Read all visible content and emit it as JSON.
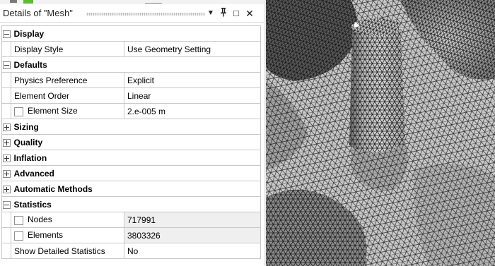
{
  "details": {
    "title": "Details of \"Mesh\"",
    "window_buttons": {
      "dropdown": "▼",
      "pin": "⊥",
      "maximize": "□",
      "close": "✕"
    },
    "rows": [
      {
        "type": "category",
        "label": "Display",
        "expanded": true
      },
      {
        "type": "property",
        "label": "Display Style",
        "value": "Use Geometry Setting",
        "checkbox": false,
        "readonly": false
      },
      {
        "type": "category",
        "label": "Defaults",
        "expanded": true
      },
      {
        "type": "property",
        "label": "Physics Preference",
        "value": "Explicit",
        "checkbox": false,
        "readonly": false
      },
      {
        "type": "property",
        "label": "Element Order",
        "value": "Linear",
        "checkbox": false,
        "readonly": false
      },
      {
        "type": "property",
        "label": "Element Size",
        "value": "2.e-005 m",
        "checkbox": true,
        "readonly": false
      },
      {
        "type": "category",
        "label": "Sizing",
        "expanded": false
      },
      {
        "type": "category",
        "label": "Quality",
        "expanded": false
      },
      {
        "type": "category",
        "label": "Inflation",
        "expanded": false
      },
      {
        "type": "category",
        "label": "Advanced",
        "expanded": false
      },
      {
        "type": "category",
        "label": "Automatic Methods",
        "expanded": false
      },
      {
        "type": "category",
        "label": "Statistics",
        "expanded": true
      },
      {
        "type": "property",
        "label": "Nodes",
        "value": "717991",
        "checkbox": true,
        "readonly": true
      },
      {
        "type": "property",
        "label": "Elements",
        "value": "3803326",
        "checkbox": true,
        "readonly": true
      },
      {
        "type": "property",
        "label": "Show Detailed Statistics",
        "value": "No",
        "checkbox": false,
        "readonly": false
      }
    ]
  },
  "viewport": {
    "content": "mesh-graphics",
    "mesh_fill": "#c4c4c4",
    "mesh_line": "#1c1c1c"
  }
}
